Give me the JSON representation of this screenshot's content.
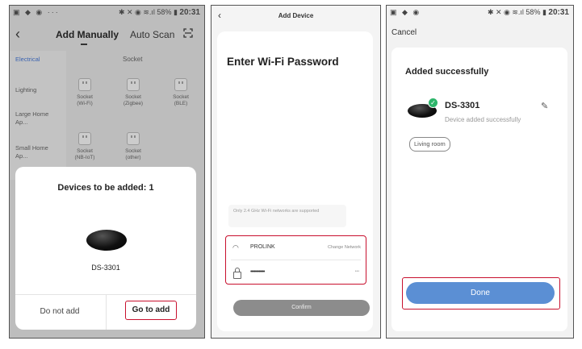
{
  "status_bar": {
    "left_icons": "▣ ◆ ◉ ···",
    "right_icons": "✱ ✕ ◉ ≋.ıl 58% ▮",
    "time": "20:31",
    "left_icons_p3": "▣ ◆ ◉",
    "right_icons_p3": "✱ ✕ ◉ ≋.ıl 58% ▮"
  },
  "screen1": {
    "tabs": {
      "manual": "Add Manually",
      "auto": "Auto Scan"
    },
    "categories": [
      "Electrical",
      "Lighting",
      "Large Home Ap...",
      "Small Home Ap..."
    ],
    "section_heading": "Socket",
    "devices": [
      {
        "line1": "Socket",
        "line2": "(Wi-Fi)"
      },
      {
        "line1": "Socket",
        "line2": "(Zigbee)"
      },
      {
        "line1": "Socket",
        "line2": "(BLE)"
      },
      {
        "line1": "Socket",
        "line2": "(NB-IoT)"
      },
      {
        "line1": "Socket",
        "line2": "(other)"
      }
    ],
    "sheet": {
      "title": "Devices to be added: 1",
      "device_name": "DS-3301",
      "not_add": "Do not add",
      "go_add": "Go to add"
    }
  },
  "screen2": {
    "title": "Add Device",
    "heading": "Enter Wi-Fi Password",
    "note": "Only 2.4 GHz Wi-Fi networks are supported",
    "ssid": "PROLINK",
    "change_network": "Change Network",
    "password_masked": "••••••••••••",
    "confirm": "Confirm"
  },
  "screen3": {
    "cancel": "Cancel",
    "title": "Added successfully",
    "device_name": "DS-3301",
    "subtitle": "Device added successfully",
    "room": "Living room",
    "done": "Done"
  },
  "colors": {
    "highlight_border": "#c8102e",
    "done_button": "#5b8fd4",
    "success_badge": "#2db56a",
    "active_category": "#3b63b0"
  }
}
